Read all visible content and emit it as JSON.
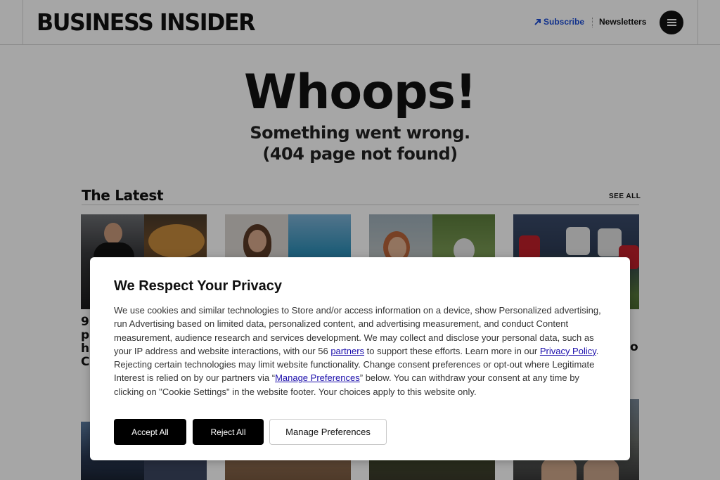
{
  "header": {
    "logo": "BUSINESS INSIDER",
    "subscribe": "Subscribe",
    "newsletters": "Newsletters"
  },
  "hero": {
    "title": "Whoops!",
    "line1": "Something went wrong.",
    "line2": "(404 page not found)"
  },
  "latest": {
    "title": "The Latest",
    "see_all": "SEE ALL",
    "card1_title_fragments": [
      "9",
      "p",
      "h",
      "C"
    ],
    "card4_title_fragment": "o"
  },
  "consent": {
    "title": "We Respect Your Privacy",
    "body_part1": "We use cookies and similar technologies to Store and/or access information on a device, show Personalized advertising, run Advertising based on limited data, personalized content, and advertising measurement, and conduct Content measurement, audience research and services development. We may collect and disclose your personal data, such as your IP address and website interactions, with our 56 ",
    "partners_link": "partners",
    "body_part2": " to support these efforts. Learn more in our ",
    "privacy_link": "Privacy Policy",
    "body_part3": ". Rejecting certain technologies may limit website functionality. Change consent preferences or opt-out where Legitimate Interest is relied on by our partners via “",
    "manage_link": "Manage Preferences",
    "body_part4": "” below. You can withdraw your consent at any time by clicking on \"Cookie Settings\" in the website footer. Your choices apply to this website only.",
    "accept": "Accept All",
    "reject": "Reject All",
    "manage": "Manage Preferences"
  },
  "colors": {
    "subscribe": "#1d4ed8",
    "link": "#1a0dab",
    "button_dark": "#000000"
  },
  "icons": [
    "arrow-up-right-icon",
    "hamburger-menu-icon"
  ]
}
